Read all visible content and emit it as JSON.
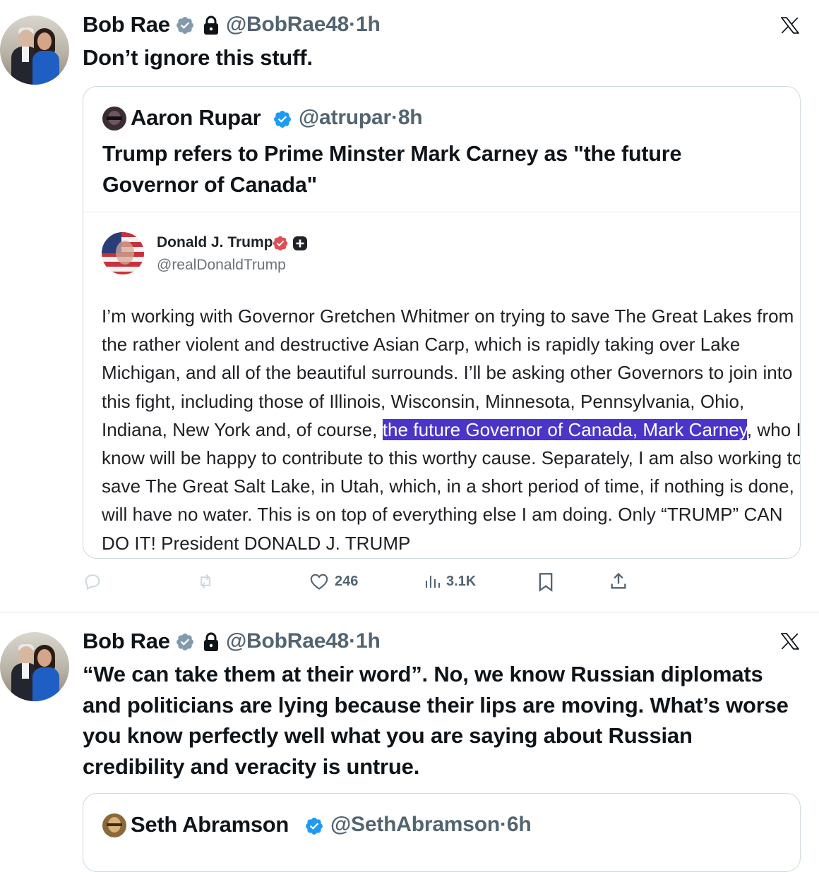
{
  "tweets": [
    {
      "author_name": "Bob Rae",
      "handle": "@BobRae48",
      "separator": "·",
      "time": "1h",
      "text": "Don’t ignore this stuff.",
      "quote": {
        "author_name": "Aaron Rupar",
        "handle": "@atrupar",
        "separator": "·",
        "time": "8h",
        "text": "Trump refers to Prime Minster Mark Carney as \"the future Governor of Canada\"",
        "embedded_post": {
          "author_name": "Donald J. Trump",
          "handle": "@realDonaldTrump",
          "text_before": "I’m working with Governor Gretchen Whitmer on trying to save The Great Lakes from the rather violent and destructive Asian Carp, which is rapidly taking over Lake Michigan, and all of the beautiful surrounds. I’ll be asking other Governors to join into this fight, including those of Illinois, Wisconsin, Minnesota, Pennsylvania, Ohio, Indiana, New York and, of course, ",
          "text_highlight": "the future Governor of Canada, Mark Carney",
          "text_after": ", who I know will be happy to contribute to this worthy cause. Separately, I am also working to save The Great Salt Lake, in Utah, which, in a short period of time, if nothing is done, will have no water. This is on top of everything else I am doing. Only “TRUMP” CAN DO IT! President DONALD J. TRUMP"
        }
      },
      "actions": {
        "likes": "246",
        "views": "3.1K"
      }
    },
    {
      "author_name": "Bob Rae",
      "handle": "@BobRae48",
      "separator": "·",
      "time": "1h",
      "text": "“We can take them at their word”.  No, we know Russian diplomats and politicians are lying because their lips are moving. What’s worse you know perfectly well what you are saying about Russian credibility and veracity is untrue.",
      "quote": {
        "author_name": "Seth Abramson",
        "handle": "@SethAbramson",
        "separator": "·",
        "time": "6h"
      }
    }
  ],
  "colors": {
    "verified_blue": "#1d9bf0",
    "truth_badge": "#e24e57",
    "highlight": "#4a35c8",
    "secondary_text": "#536471"
  },
  "icons": [
    "verified-badge-icon",
    "lock-icon",
    "x-logo-icon",
    "reply-icon",
    "repost-icon",
    "like-icon",
    "views-icon",
    "bookmark-icon",
    "share-icon"
  ]
}
